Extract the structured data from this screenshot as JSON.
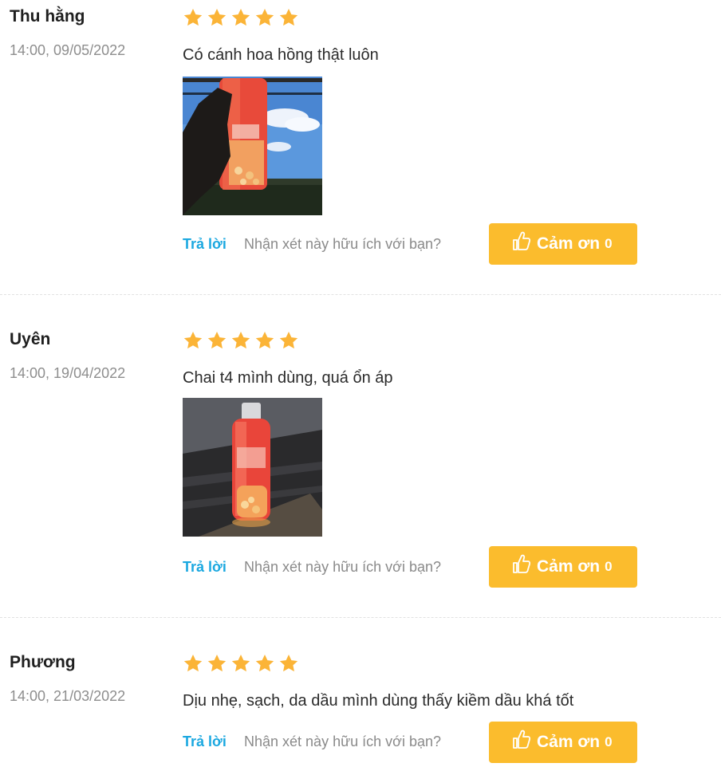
{
  "ui": {
    "reply_label": "Trả lời",
    "helpful_question": "Nhận xét này hữu ích với bạn?",
    "thanks_label": "Cảm ơn",
    "star_color": "#fbb437",
    "button_color": "#fbbc2d",
    "reply_color": "#1ba8e0"
  },
  "reviews": [
    {
      "author": "Thu hằng",
      "date": "14:00, 09/05/2022",
      "rating": 5,
      "comment": "Có cánh hoa hồng thật luôn",
      "thanks_count": "0"
    },
    {
      "author": "Uyên",
      "date": "14:00, 19/04/2022",
      "rating": 5,
      "comment": "Chai t4 mình dùng, quá ổn áp",
      "thanks_count": "0"
    },
    {
      "author": "Phương",
      "date": "14:00, 21/03/2022",
      "rating": 5,
      "comment": "Dịu nhẹ, sạch, da dầu mình dùng thấy kiềm dầu khá tốt",
      "thanks_count": "0"
    }
  ]
}
